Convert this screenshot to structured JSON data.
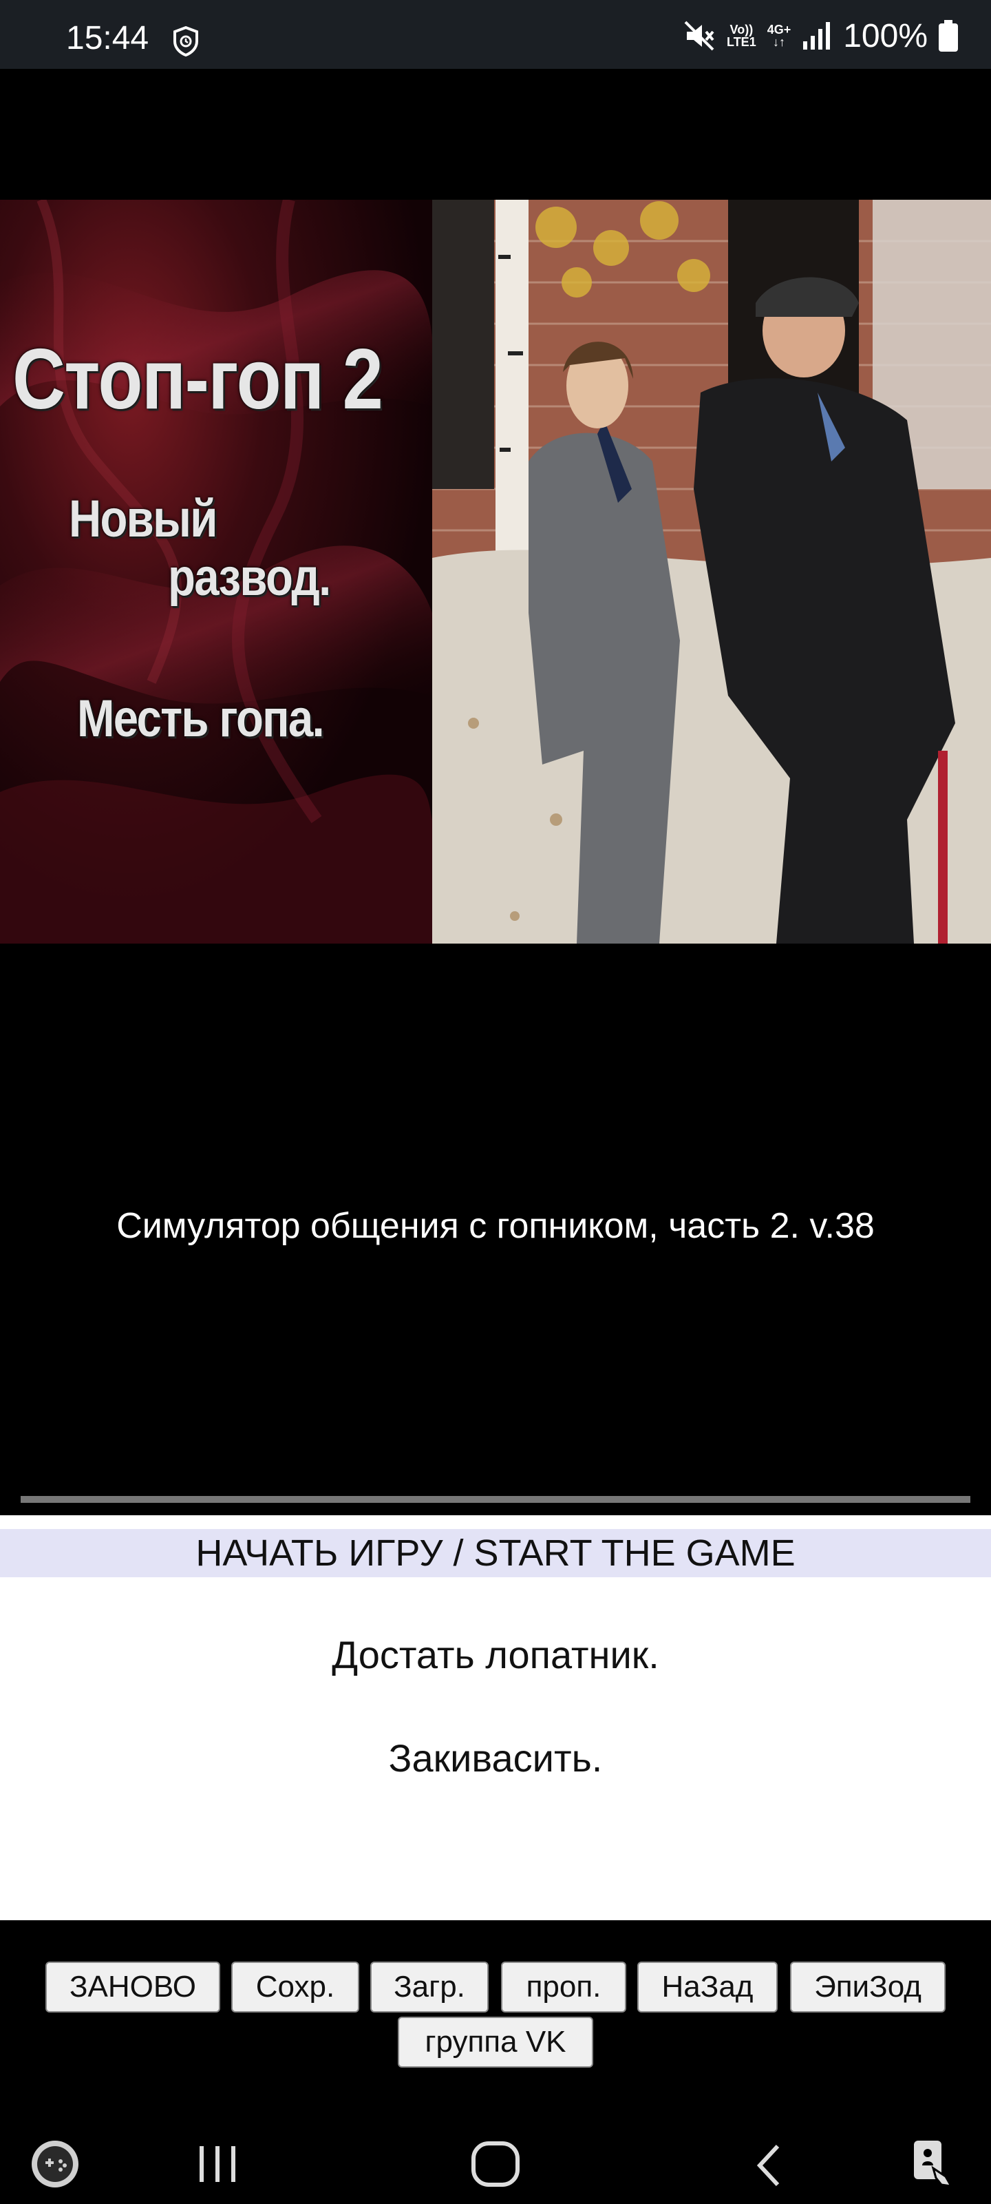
{
  "status_bar": {
    "time": "15:44",
    "battery_text": "100%",
    "volte_label_top": "Vo))",
    "volte_label_bottom": "LTE1",
    "network_type": "4G+"
  },
  "game": {
    "cover_title": "Стоп-гоп 2",
    "cover_line1": "Новый",
    "cover_line2": "развод.",
    "cover_line3": "Месть гопа.",
    "subtitle": "Симулятор общения с гопником, часть 2. v.38"
  },
  "choices": {
    "header": "НАЧАТЬ ИГРУ / START THE GAME",
    "items": [
      "Достать лопатник.",
      "Закивасить."
    ]
  },
  "toolbar": {
    "buttons": [
      "ЗАНОВО",
      "Сохр.",
      "Загр.",
      "проп.",
      "НаЗад",
      "ЭпиЗод",
      "группа VK"
    ]
  },
  "navbar": {
    "icons": [
      "game-launcher-icon",
      "recent-apps-icon",
      "home-icon",
      "back-icon",
      "accessibility-icon"
    ]
  }
}
